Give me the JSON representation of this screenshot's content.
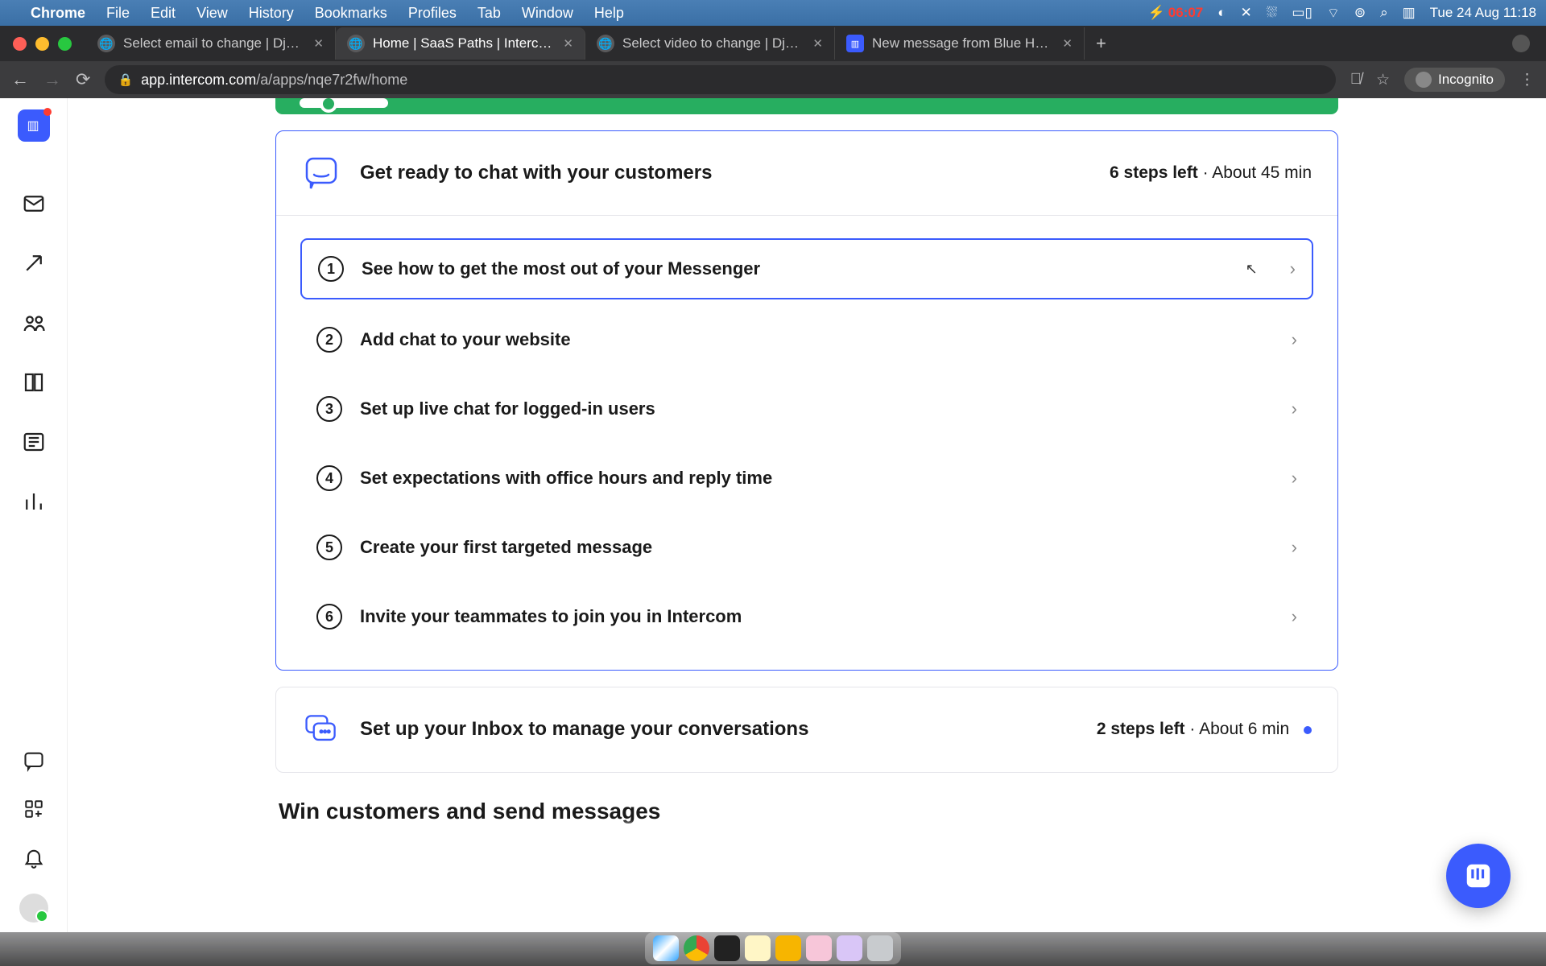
{
  "menubar": {
    "app_name": "Chrome",
    "items": [
      "File",
      "Edit",
      "View",
      "History",
      "Bookmarks",
      "Profiles",
      "Tab",
      "Window",
      "Help"
    ],
    "battery_time": "06:07",
    "date_time": "Tue 24 Aug  11:18"
  },
  "browser": {
    "tabs": [
      {
        "label": "Select email to change | Djang",
        "favicon": "globe"
      },
      {
        "label": "Home | SaaS Paths | Intercom",
        "favicon": "globe",
        "active": true
      },
      {
        "label": "Select video to change | Djang",
        "favicon": "globe"
      },
      {
        "label": "New message from Blue Helico",
        "favicon": "intercom"
      }
    ],
    "url_host": "app.intercom.com",
    "url_path": "/a/apps/nqe7r2fw/home",
    "incognito_label": "Incognito"
  },
  "card_chat": {
    "title": "Get ready to chat with your customers",
    "steps_left": "6 steps left",
    "time_est": "About 45 min",
    "steps": [
      {
        "n": "1",
        "label": "See how to get the most out of your Messenger",
        "highlighted": true
      },
      {
        "n": "2",
        "label": "Add chat to your website"
      },
      {
        "n": "3",
        "label": "Set up live chat for logged-in users"
      },
      {
        "n": "4",
        "label": "Set expectations with office hours and reply time"
      },
      {
        "n": "5",
        "label": "Create your first targeted message"
      },
      {
        "n": "6",
        "label": "Invite your teammates to join you in Intercom"
      }
    ]
  },
  "card_inbox": {
    "title": "Set up your Inbox to manage your conversations",
    "steps_left": "2 steps left",
    "time_est": "About 6 min"
  },
  "section_heading": "Win customers and send messages"
}
